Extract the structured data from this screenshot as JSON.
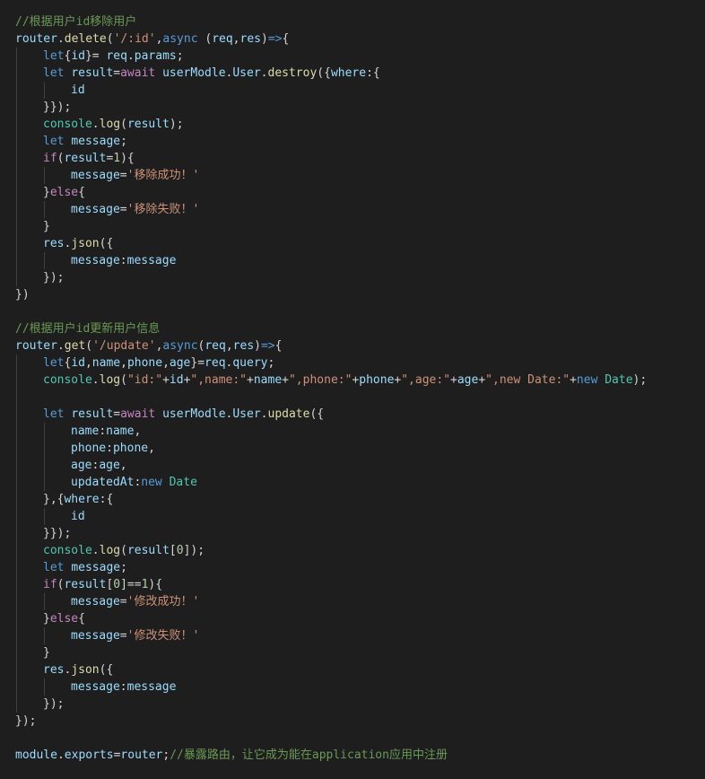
{
  "theme": {
    "background": "#1e1e1e",
    "colors": {
      "c": "#6a9955",
      "k": "#569cd6",
      "f": "#dcdcaa",
      "v": "#9cdcfe",
      "t": "#4ec9b0",
      "s": "#ce9178",
      "n": "#b5cea8",
      "ctl": "#c586c0",
      "p": "#d4d4d4"
    }
  },
  "lines": [
    {
      "indent": 0,
      "tokens": [
        {
          "t": "//根据用户id移除用户",
          "c": "c"
        }
      ]
    },
    {
      "indent": 0,
      "tokens": [
        {
          "t": "router",
          "c": "v"
        },
        {
          "t": ".",
          "c": "p"
        },
        {
          "t": "delete",
          "c": "f"
        },
        {
          "t": "(",
          "c": "p"
        },
        {
          "t": "'/:id'",
          "c": "s"
        },
        {
          "t": ",",
          "c": "p"
        },
        {
          "t": "async",
          "c": "k"
        },
        {
          "t": " (",
          "c": "p"
        },
        {
          "t": "req",
          "c": "v"
        },
        {
          "t": ",",
          "c": "p"
        },
        {
          "t": "res",
          "c": "v"
        },
        {
          "t": ")",
          "c": "p"
        },
        {
          "t": "=>",
          "c": "k"
        },
        {
          "t": "{",
          "c": "p"
        }
      ]
    },
    {
      "indent": 1,
      "tokens": [
        {
          "t": "let",
          "c": "k"
        },
        {
          "t": "{",
          "c": "p"
        },
        {
          "t": "id",
          "c": "v"
        },
        {
          "t": "}= ",
          "c": "p"
        },
        {
          "t": "req",
          "c": "v"
        },
        {
          "t": ".",
          "c": "p"
        },
        {
          "t": "params",
          "c": "v"
        },
        {
          "t": ";",
          "c": "p"
        }
      ]
    },
    {
      "indent": 1,
      "tokens": [
        {
          "t": "let",
          "c": "k"
        },
        {
          "t": " ",
          "c": "p"
        },
        {
          "t": "result",
          "c": "v"
        },
        {
          "t": "=",
          "c": "p"
        },
        {
          "t": "await",
          "c": "ctl"
        },
        {
          "t": " ",
          "c": "p"
        },
        {
          "t": "userModle",
          "c": "v"
        },
        {
          "t": ".",
          "c": "p"
        },
        {
          "t": "User",
          "c": "v"
        },
        {
          "t": ".",
          "c": "p"
        },
        {
          "t": "destroy",
          "c": "f"
        },
        {
          "t": "({",
          "c": "p"
        },
        {
          "t": "where",
          "c": "v"
        },
        {
          "t": ":{",
          "c": "p"
        }
      ]
    },
    {
      "indent": 2,
      "tokens": [
        {
          "t": "id",
          "c": "v"
        }
      ]
    },
    {
      "indent": 1,
      "tokens": [
        {
          "t": "}});",
          "c": "p"
        }
      ]
    },
    {
      "indent": 1,
      "tokens": [
        {
          "t": "console",
          "c": "t"
        },
        {
          "t": ".",
          "c": "p"
        },
        {
          "t": "log",
          "c": "f"
        },
        {
          "t": "(",
          "c": "p"
        },
        {
          "t": "result",
          "c": "v"
        },
        {
          "t": ");",
          "c": "p"
        }
      ]
    },
    {
      "indent": 1,
      "tokens": [
        {
          "t": "let",
          "c": "k"
        },
        {
          "t": " ",
          "c": "p"
        },
        {
          "t": "message",
          "c": "v"
        },
        {
          "t": ";",
          "c": "p"
        }
      ]
    },
    {
      "indent": 1,
      "tokens": [
        {
          "t": "if",
          "c": "ctl"
        },
        {
          "t": "(",
          "c": "p"
        },
        {
          "t": "result",
          "c": "v"
        },
        {
          "t": "=",
          "c": "p"
        },
        {
          "t": "1",
          "c": "n"
        },
        {
          "t": "){",
          "c": "p"
        }
      ]
    },
    {
      "indent": 2,
      "tokens": [
        {
          "t": "message",
          "c": "v"
        },
        {
          "t": "=",
          "c": "p"
        },
        {
          "t": "'移除成功！'",
          "c": "s"
        }
      ]
    },
    {
      "indent": 1,
      "tokens": [
        {
          "t": "}",
          "c": "p"
        },
        {
          "t": "else",
          "c": "ctl"
        },
        {
          "t": "{",
          "c": "p"
        }
      ]
    },
    {
      "indent": 2,
      "tokens": [
        {
          "t": "message",
          "c": "v"
        },
        {
          "t": "=",
          "c": "p"
        },
        {
          "t": "'移除失败！'",
          "c": "s"
        }
      ]
    },
    {
      "indent": 1,
      "tokens": [
        {
          "t": "}",
          "c": "p"
        }
      ]
    },
    {
      "indent": 1,
      "tokens": [
        {
          "t": "res",
          "c": "v"
        },
        {
          "t": ".",
          "c": "p"
        },
        {
          "t": "json",
          "c": "f"
        },
        {
          "t": "({",
          "c": "p"
        }
      ]
    },
    {
      "indent": 2,
      "tokens": [
        {
          "t": "message",
          "c": "v"
        },
        {
          "t": ":",
          "c": "p"
        },
        {
          "t": "message",
          "c": "v"
        }
      ]
    },
    {
      "indent": 1,
      "tokens": [
        {
          "t": "});",
          "c": "p"
        }
      ]
    },
    {
      "indent": 0,
      "tokens": [
        {
          "t": "})",
          "c": "p"
        }
      ]
    },
    {
      "indent": 0,
      "tokens": []
    },
    {
      "indent": 0,
      "tokens": [
        {
          "t": "//根据用户id更新用户信息",
          "c": "c"
        }
      ]
    },
    {
      "indent": 0,
      "tokens": [
        {
          "t": "router",
          "c": "v"
        },
        {
          "t": ".",
          "c": "p"
        },
        {
          "t": "get",
          "c": "f"
        },
        {
          "t": "(",
          "c": "p"
        },
        {
          "t": "'/update'",
          "c": "s"
        },
        {
          "t": ",",
          "c": "p"
        },
        {
          "t": "async",
          "c": "k"
        },
        {
          "t": "(",
          "c": "p"
        },
        {
          "t": "req",
          "c": "v"
        },
        {
          "t": ",",
          "c": "p"
        },
        {
          "t": "res",
          "c": "v"
        },
        {
          "t": ")",
          "c": "p"
        },
        {
          "t": "=>",
          "c": "k"
        },
        {
          "t": "{",
          "c": "p"
        }
      ]
    },
    {
      "indent": 1,
      "tokens": [
        {
          "t": "let",
          "c": "k"
        },
        {
          "t": "{",
          "c": "p"
        },
        {
          "t": "id",
          "c": "v"
        },
        {
          "t": ",",
          "c": "p"
        },
        {
          "t": "name",
          "c": "v"
        },
        {
          "t": ",",
          "c": "p"
        },
        {
          "t": "phone",
          "c": "v"
        },
        {
          "t": ",",
          "c": "p"
        },
        {
          "t": "age",
          "c": "v"
        },
        {
          "t": "}=",
          "c": "p"
        },
        {
          "t": "req",
          "c": "v"
        },
        {
          "t": ".",
          "c": "p"
        },
        {
          "t": "query",
          "c": "v"
        },
        {
          "t": ";",
          "c": "p"
        }
      ]
    },
    {
      "indent": 1,
      "tokens": [
        {
          "t": "console",
          "c": "t"
        },
        {
          "t": ".",
          "c": "p"
        },
        {
          "t": "log",
          "c": "f"
        },
        {
          "t": "(",
          "c": "p"
        },
        {
          "t": "\"id:\"",
          "c": "s"
        },
        {
          "t": "+",
          "c": "p"
        },
        {
          "t": "id",
          "c": "v"
        },
        {
          "t": "+",
          "c": "p"
        },
        {
          "t": "\",name:\"",
          "c": "s"
        },
        {
          "t": "+",
          "c": "p"
        },
        {
          "t": "name",
          "c": "v"
        },
        {
          "t": "+",
          "c": "p"
        },
        {
          "t": "\",phone:\"",
          "c": "s"
        },
        {
          "t": "+",
          "c": "p"
        },
        {
          "t": "phone",
          "c": "v"
        },
        {
          "t": "+",
          "c": "p"
        },
        {
          "t": "\",age:\"",
          "c": "s"
        },
        {
          "t": "+",
          "c": "p"
        },
        {
          "t": "age",
          "c": "v"
        },
        {
          "t": "+",
          "c": "p"
        },
        {
          "t": "\",new Date:\"",
          "c": "s"
        },
        {
          "t": "+",
          "c": "p"
        },
        {
          "t": "new",
          "c": "k"
        },
        {
          "t": " ",
          "c": "p"
        },
        {
          "t": "Date",
          "c": "t"
        },
        {
          "t": ");",
          "c": "p"
        }
      ]
    },
    {
      "indent": 1,
      "tokens": []
    },
    {
      "indent": 1,
      "tokens": [
        {
          "t": "let",
          "c": "k"
        },
        {
          "t": " ",
          "c": "p"
        },
        {
          "t": "result",
          "c": "v"
        },
        {
          "t": "=",
          "c": "p"
        },
        {
          "t": "await",
          "c": "ctl"
        },
        {
          "t": " ",
          "c": "p"
        },
        {
          "t": "userModle",
          "c": "v"
        },
        {
          "t": ".",
          "c": "p"
        },
        {
          "t": "User",
          "c": "v"
        },
        {
          "t": ".",
          "c": "p"
        },
        {
          "t": "update",
          "c": "f"
        },
        {
          "t": "({",
          "c": "p"
        }
      ]
    },
    {
      "indent": 2,
      "tokens": [
        {
          "t": "name",
          "c": "v"
        },
        {
          "t": ":",
          "c": "p"
        },
        {
          "t": "name",
          "c": "v"
        },
        {
          "t": ",",
          "c": "p"
        }
      ]
    },
    {
      "indent": 2,
      "tokens": [
        {
          "t": "phone",
          "c": "v"
        },
        {
          "t": ":",
          "c": "p"
        },
        {
          "t": "phone",
          "c": "v"
        },
        {
          "t": ",",
          "c": "p"
        }
      ]
    },
    {
      "indent": 2,
      "tokens": [
        {
          "t": "age",
          "c": "v"
        },
        {
          "t": ":",
          "c": "p"
        },
        {
          "t": "age",
          "c": "v"
        },
        {
          "t": ",",
          "c": "p"
        }
      ]
    },
    {
      "indent": 2,
      "tokens": [
        {
          "t": "updatedAt",
          "c": "v"
        },
        {
          "t": ":",
          "c": "p"
        },
        {
          "t": "new",
          "c": "k"
        },
        {
          "t": " ",
          "c": "p"
        },
        {
          "t": "Date",
          "c": "t"
        }
      ]
    },
    {
      "indent": 1,
      "tokens": [
        {
          "t": "},{",
          "c": "p"
        },
        {
          "t": "where",
          "c": "v"
        },
        {
          "t": ":{",
          "c": "p"
        }
      ]
    },
    {
      "indent": 2,
      "tokens": [
        {
          "t": "id",
          "c": "v"
        }
      ]
    },
    {
      "indent": 1,
      "tokens": [
        {
          "t": "}});",
          "c": "p"
        }
      ]
    },
    {
      "indent": 1,
      "tokens": [
        {
          "t": "console",
          "c": "t"
        },
        {
          "t": ".",
          "c": "p"
        },
        {
          "t": "log",
          "c": "f"
        },
        {
          "t": "(",
          "c": "p"
        },
        {
          "t": "result",
          "c": "v"
        },
        {
          "t": "[",
          "c": "p"
        },
        {
          "t": "0",
          "c": "n"
        },
        {
          "t": "]);",
          "c": "p"
        }
      ]
    },
    {
      "indent": 1,
      "tokens": [
        {
          "t": "let",
          "c": "k"
        },
        {
          "t": " ",
          "c": "p"
        },
        {
          "t": "message",
          "c": "v"
        },
        {
          "t": ";",
          "c": "p"
        }
      ]
    },
    {
      "indent": 1,
      "tokens": [
        {
          "t": "if",
          "c": "ctl"
        },
        {
          "t": "(",
          "c": "p"
        },
        {
          "t": "result",
          "c": "v"
        },
        {
          "t": "[",
          "c": "p"
        },
        {
          "t": "0",
          "c": "n"
        },
        {
          "t": "]==",
          "c": "p"
        },
        {
          "t": "1",
          "c": "n"
        },
        {
          "t": "){",
          "c": "p"
        }
      ]
    },
    {
      "indent": 2,
      "tokens": [
        {
          "t": "message",
          "c": "v"
        },
        {
          "t": "=",
          "c": "p"
        },
        {
          "t": "'修改成功！'",
          "c": "s"
        }
      ]
    },
    {
      "indent": 1,
      "tokens": [
        {
          "t": "}",
          "c": "p"
        },
        {
          "t": "else",
          "c": "ctl"
        },
        {
          "t": "{",
          "c": "p"
        }
      ]
    },
    {
      "indent": 2,
      "tokens": [
        {
          "t": "message",
          "c": "v"
        },
        {
          "t": "=",
          "c": "p"
        },
        {
          "t": "'修改失败！'",
          "c": "s"
        }
      ]
    },
    {
      "indent": 1,
      "tokens": [
        {
          "t": "}",
          "c": "p"
        }
      ]
    },
    {
      "indent": 1,
      "tokens": [
        {
          "t": "res",
          "c": "v"
        },
        {
          "t": ".",
          "c": "p"
        },
        {
          "t": "json",
          "c": "f"
        },
        {
          "t": "({",
          "c": "p"
        }
      ]
    },
    {
      "indent": 2,
      "tokens": [
        {
          "t": "message",
          "c": "v"
        },
        {
          "t": ":",
          "c": "p"
        },
        {
          "t": "message",
          "c": "v"
        }
      ]
    },
    {
      "indent": 1,
      "tokens": [
        {
          "t": "});",
          "c": "p"
        }
      ]
    },
    {
      "indent": 0,
      "tokens": [
        {
          "t": "});",
          "c": "p"
        }
      ]
    },
    {
      "indent": 0,
      "tokens": []
    },
    {
      "indent": 0,
      "tokens": [
        {
          "t": "module",
          "c": "v"
        },
        {
          "t": ".",
          "c": "p"
        },
        {
          "t": "exports",
          "c": "v"
        },
        {
          "t": "=",
          "c": "p"
        },
        {
          "t": "router",
          "c": "v"
        },
        {
          "t": ";",
          "c": "p"
        },
        {
          "t": "//暴露路由，让它成为能在application应用中注册",
          "c": "c"
        }
      ]
    }
  ]
}
